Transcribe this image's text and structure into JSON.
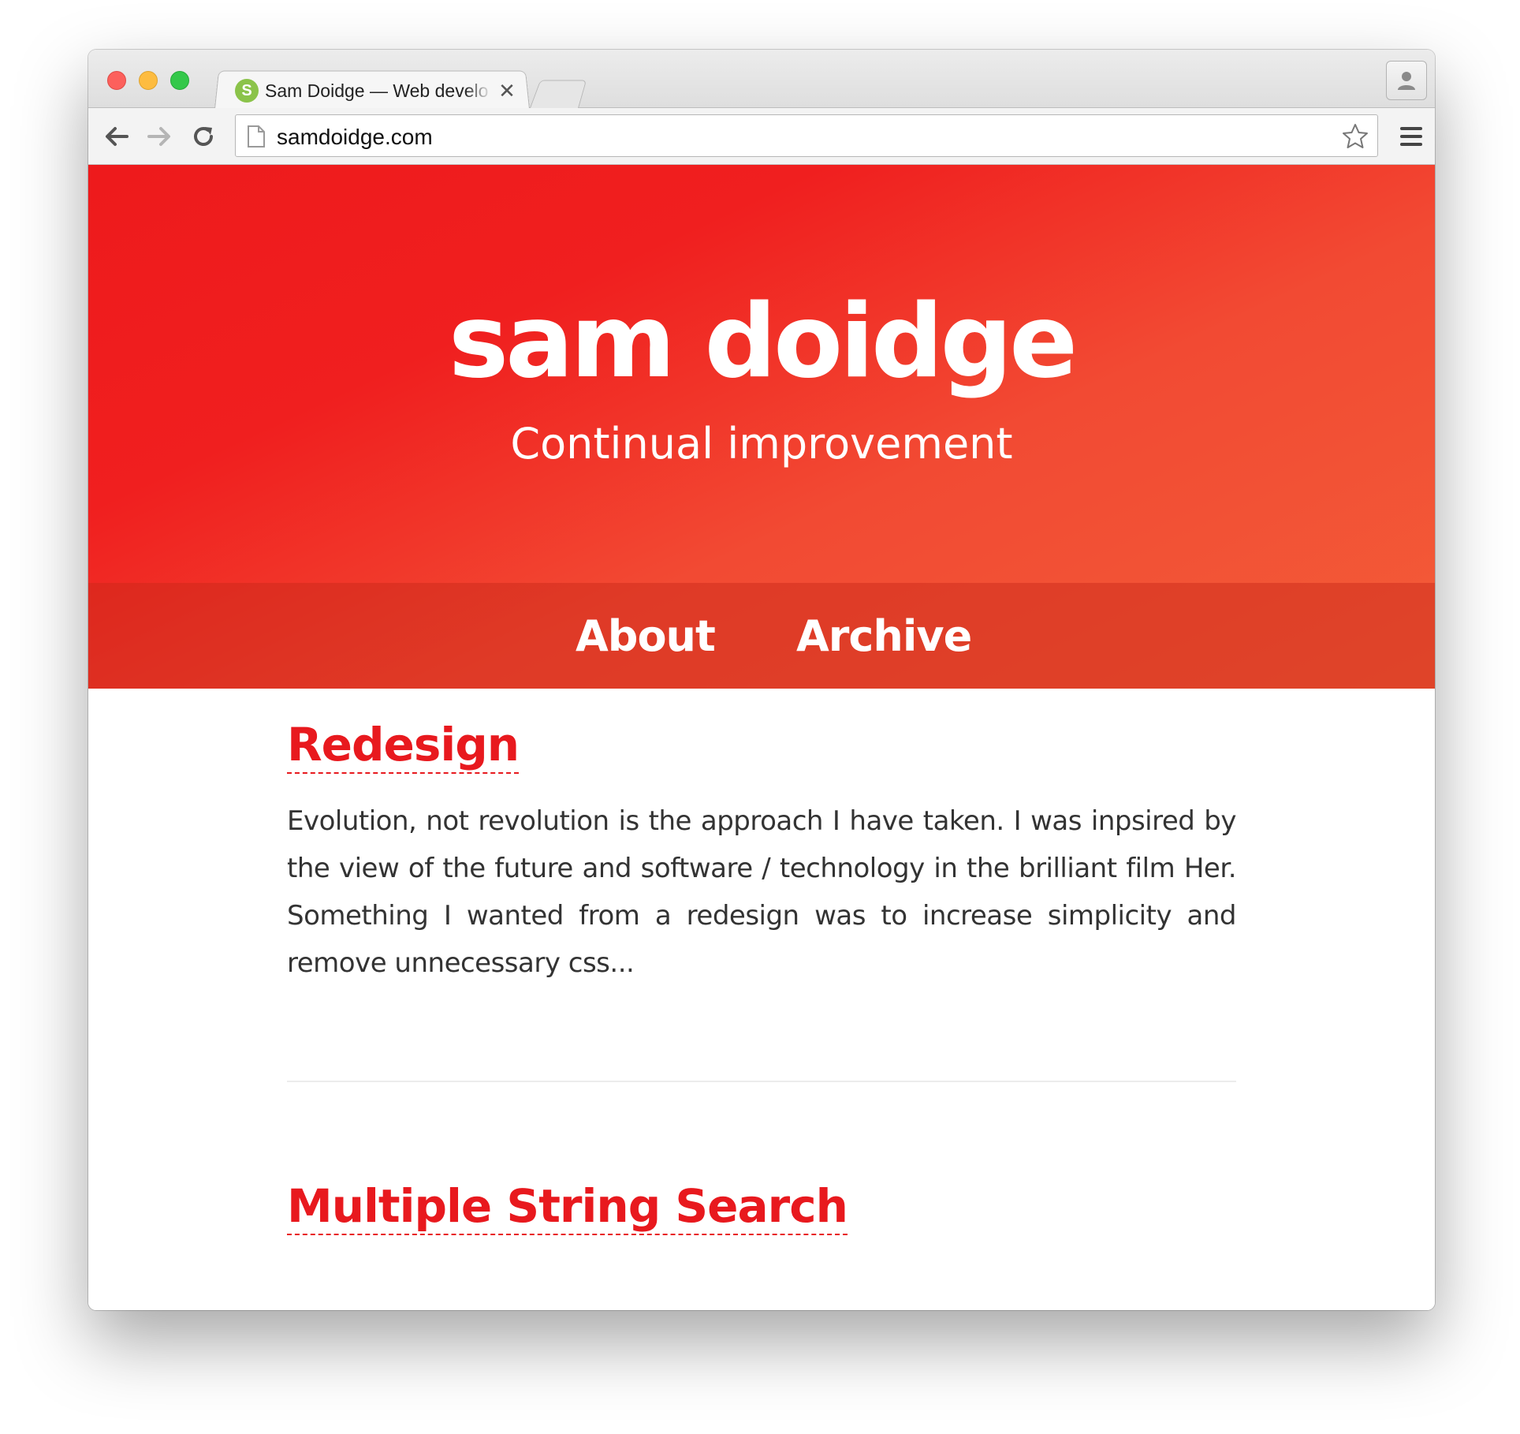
{
  "browser": {
    "tab": {
      "title": "Sam Doidge — Web develo",
      "favicon_letter": "S",
      "close_glyph": "✕"
    },
    "address_bar": {
      "url": "samdoidge.com"
    },
    "icons": [
      "close-window-icon",
      "minimize-window-icon",
      "maximize-window-icon",
      "profile-icon",
      "back-arrow-icon",
      "forward-arrow-icon",
      "reload-icon",
      "page-icon",
      "bookmark-star-icon",
      "menu-icon"
    ]
  },
  "site": {
    "title": "sam doidge",
    "tagline": "Continual improvement",
    "nav": [
      {
        "label": "About"
      },
      {
        "label": "Archive"
      }
    ]
  },
  "posts": [
    {
      "title": "Redesign",
      "excerpt": "Evolution, not revolution is the approach I have taken. I was inpsired by the view of the future and software / technology in the brilliant film Her. Something I wanted from a redesign was to increase simplicity and remove unnecessary css..."
    },
    {
      "title": "Multiple String Search"
    }
  ],
  "colors": {
    "header_start": "#ee1a1c",
    "header_end": "#f35c38",
    "post_title": "#e8191e",
    "body_text": "#333333"
  }
}
